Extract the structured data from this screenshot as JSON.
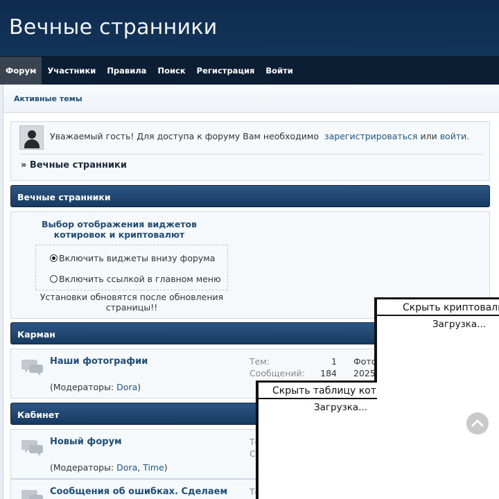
{
  "site": {
    "title": "Вечные странники"
  },
  "nav": {
    "items": [
      "Форум",
      "Участники",
      "Правила",
      "Поиск",
      "Регистрация",
      "Войти"
    ]
  },
  "crumbs": {
    "active_topics": "Активные темы"
  },
  "guest": {
    "text_before": "Уважаемый гость! Для доступа к форуму Вам необходимо",
    "register_link": "зарегистрироваться",
    "or": "или",
    "login_link": "войти.",
    "crumb": "» Вечные странники"
  },
  "categories": {
    "first": "Вечные странники",
    "second": "Карман",
    "third": "Кабинет"
  },
  "widget_settings": {
    "heading": "Выбор отображения виджетов котировок и криптовалют",
    "option_bottom": "Включить виджеты внизу форума",
    "option_link": "Включить ссылкой в главном меню",
    "selected": "option_bottom",
    "note": "Установки обновятся после обновления страницы!!"
  },
  "forums": [
    {
      "name": "Наши фотографии",
      "moderators_prefix": "(Модераторы:",
      "moderators": [
        "Dora"
      ],
      "moderators_suffix": ")",
      "topics_label": "Тем:",
      "topics": "1",
      "posts_label": "Сообщений:",
      "posts": "184",
      "last_title": "Фото",
      "last_date": "2025"
    },
    {
      "name": "Новый форум",
      "moderators_prefix": "(Модераторы:",
      "moderators": [
        "Dora",
        "Time"
      ],
      "moderators_suffix": ")",
      "topics_label": "Те",
      "posts_label": "Со"
    },
    {
      "name": "Сообщения об ошибках. Сделаем",
      "topics_label": "Те"
    }
  ],
  "overlays": {
    "crypto_toggle": "Скрыть криптовалюты",
    "crypto_loading": "Загрузка...",
    "rates_toggle": "Скрыть таблицу котировок",
    "rates_loading": "Загрузка..."
  },
  "colors": {
    "header_bg": "#12345a",
    "nav_bg": "#0c1e33",
    "nav_active": "#3a4350",
    "link": "#1f5587",
    "category_header": "#1f4670"
  },
  "icons": [
    "avatar-placeholder-icon",
    "forum-bubbles-icon",
    "scroll-top-chevron-icon"
  ]
}
